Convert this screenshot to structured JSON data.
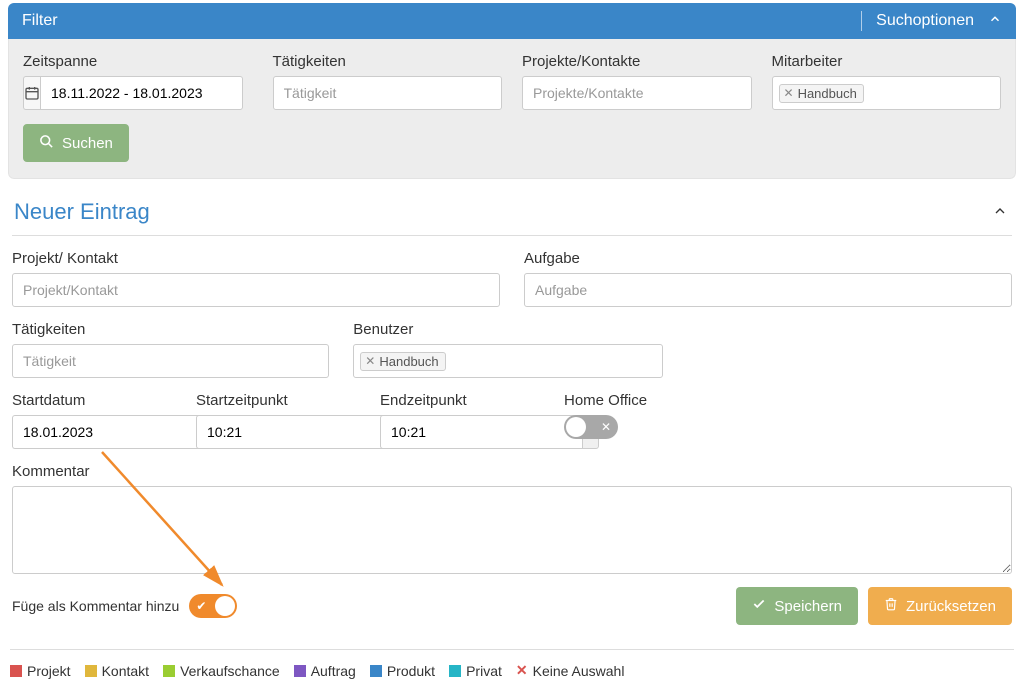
{
  "filter": {
    "title": "Filter",
    "search_options": "Suchoptionen",
    "timespan_label": "Zeitspanne",
    "timespan_value": "18.11.2022 - 18.01.2023",
    "activities_label": "Tätigkeiten",
    "activities_placeholder": "Tätigkeit",
    "projects_label": "Projekte/Kontakte",
    "projects_placeholder": "Projekte/Kontakte",
    "staff_label": "Mitarbeiter",
    "staff_tag": "Handbuch",
    "search_btn": "Suchen"
  },
  "entry": {
    "title": "Neuer Eintrag",
    "project_label": "Projekt/ Kontakt",
    "project_placeholder": "Projekt/Kontakt",
    "task_label": "Aufgabe",
    "task_placeholder": "Aufgabe",
    "activities_label": "Tätigkeiten",
    "activities_placeholder": "Tätigkeit",
    "user_label": "Benutzer",
    "user_tag": "Handbuch",
    "startdate_label": "Startdatum",
    "startdate_value": "18.01.2023",
    "starttime_label": "Startzeitpunkt",
    "starttime_value": "10:21",
    "endtime_label": "Endzeitpunkt",
    "endtime_value": "10:21",
    "homeoffice_label": "Home Office",
    "comment_label": "Kommentar",
    "add_as_comment": "Füge als Kommentar hinzu",
    "save_btn": "Speichern",
    "reset_btn": "Zurücksetzen"
  },
  "legend": {
    "project": "Projekt",
    "contact": "Kontakt",
    "opportunity": "Verkaufschance",
    "order": "Auftrag",
    "product": "Produkt",
    "private": "Privat",
    "none": "Keine Auswahl"
  },
  "colors": {
    "project": "#d9534f",
    "contact": "#e0b73c",
    "opportunity": "#9acd32",
    "order": "#7e57c2",
    "product": "#3a86c8",
    "private": "#26b5c6"
  }
}
